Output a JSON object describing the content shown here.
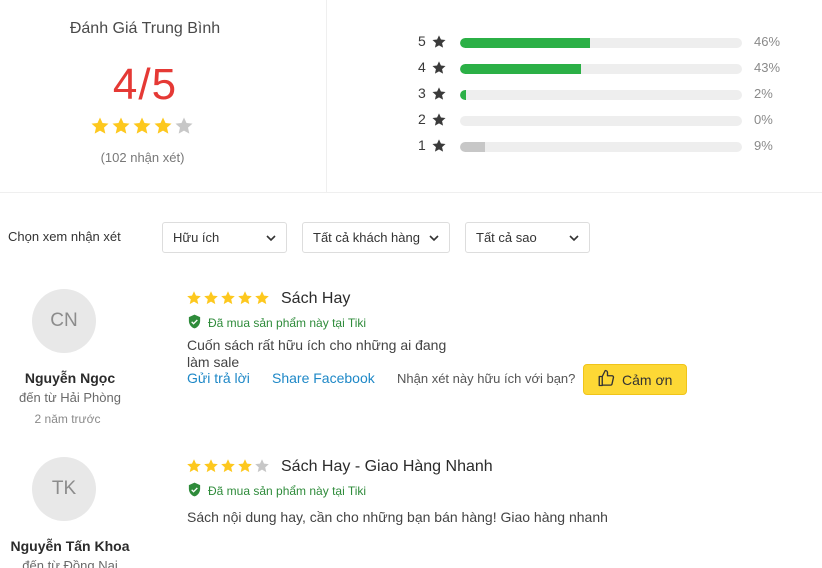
{
  "summary": {
    "title": "Đánh Giá Trung Bình",
    "score": "4/5",
    "rating": 4,
    "max_rating": 5,
    "count_text": "(102 nhận xét)"
  },
  "distribution": [
    {
      "level": "5",
      "percent_text": "46%",
      "fraction": 0.46,
      "color": "#2bb046"
    },
    {
      "level": "4",
      "percent_text": "43%",
      "fraction": 0.43,
      "color": "#2bb046"
    },
    {
      "level": "3",
      "percent_text": "2%",
      "fraction": 0.02,
      "color": "#2bb046"
    },
    {
      "level": "2",
      "percent_text": "0%",
      "fraction": 0.0,
      "color": "#2bb046"
    },
    {
      "level": "1",
      "percent_text": "9%",
      "fraction": 0.09,
      "color": "#c7c7c7"
    }
  ],
  "filters": {
    "label": "Chọn xem nhận xét",
    "sort": "Hữu ích",
    "customer": "Tất cả khách hàng",
    "stars": "Tất cả sao"
  },
  "reviews": [
    {
      "initials": "CN",
      "name": "Nguyễn Ngọc",
      "location": "đến từ Hải Phòng",
      "time": "2 năm trước",
      "rating": 5,
      "title": "Sách Hay",
      "verified": "Đã mua sản phẩm này tại Tiki",
      "content_line1": "Cuốn sách rất hữu ích cho những ai đang",
      "content_line2": "làm sale",
      "reply": "Gửi trả lời",
      "share": "Share Facebook",
      "helpful_question": "Nhận xét này hữu ích với bạn?",
      "thanks": "Cảm ơn"
    },
    {
      "initials": "TK",
      "name": "Nguyễn Tấn Khoa",
      "location": "đến từ Đồng Nai",
      "rating": 4,
      "title": "Sách Hay - Giao Hàng Nhanh",
      "verified": "Đã mua sản phẩm này tại Tiki",
      "content": "Sách nội dung hay, cần cho những bạn bán hàng! Giao hàng nhanh"
    }
  ],
  "colors": {
    "star_filled": "#fdc81e",
    "star_empty": "#c7c7c7",
    "score_red": "#e53935",
    "verified_green": "#2e8b3a",
    "link_blue": "#1e88c7",
    "thanks_yellow": "#fdd835"
  },
  "icons": {
    "star": "star-icon",
    "verified": "shield-check-icon",
    "dropdown": "chevron-down-icon",
    "thanks": "thumbs-up-icon"
  }
}
